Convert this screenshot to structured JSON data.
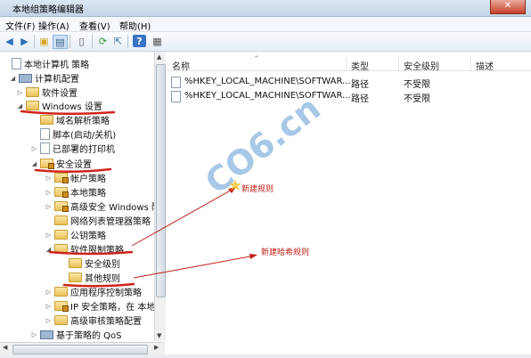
{
  "window": {
    "title": "本地组策略编辑器",
    "close_glyph": "✕"
  },
  "menu": [
    "文件(F)",
    "操作(A)",
    "查看(V)",
    "帮助(H)"
  ],
  "toolbar_icons": [
    "back-icon",
    "forward-icon",
    "up-folder-icon",
    "show-hide-tree-icon",
    "properties-icon",
    "refresh-icon",
    "export-icon",
    "help-icon",
    "view-icon"
  ],
  "tree": [
    {
      "label": "本地计算机 策略",
      "expander": "",
      "icon": "doc"
    },
    {
      "label": "计算机配置",
      "expander": "◢",
      "icon": "comp"
    },
    {
      "label": "软件设置",
      "expander": "▷",
      "icon": "folder"
    },
    {
      "label": "Windows 设置",
      "expander": "◢",
      "icon": "folder"
    },
    {
      "label": "域名解析策略",
      "expander": "",
      "icon": "folder"
    },
    {
      "label": "脚本(启动/关机)",
      "expander": "",
      "icon": "doc"
    },
    {
      "label": "已部署的打印机",
      "expander": "▷",
      "icon": "doc"
    },
    {
      "label": "安全设置",
      "expander": "◢",
      "icon": "lock"
    },
    {
      "label": "帐户策略",
      "expander": "▷",
      "icon": "lock"
    },
    {
      "label": "本地策略",
      "expander": "▷",
      "icon": "lock"
    },
    {
      "label": "高级安全 Windows 防",
      "expander": "▷",
      "icon": "lock"
    },
    {
      "label": "网络列表管理器策略",
      "expander": "",
      "icon": "folder"
    },
    {
      "label": "公钥策略",
      "expander": "▷",
      "icon": "folder"
    },
    {
      "label": "软件限制策略",
      "expander": "◢",
      "icon": "folder"
    },
    {
      "label": "安全级别",
      "expander": "",
      "icon": "folder"
    },
    {
      "label": "其他规则",
      "expander": "",
      "icon": "folder"
    },
    {
      "label": "应用程序控制策略",
      "expander": "▷",
      "icon": "folder"
    },
    {
      "label": "IP 安全策略，在 本地",
      "expander": "▷",
      "icon": "lock"
    },
    {
      "label": "高级审核策略配置",
      "expander": "▷",
      "icon": "folder"
    },
    {
      "label": "基于策略的 QoS",
      "expander": "▷",
      "icon": "comp"
    }
  ],
  "list": {
    "headers": {
      "name": "名称",
      "type": "类型",
      "level": "安全级别",
      "desc": "描述"
    },
    "rows": [
      {
        "name": "%HKEY_LOCAL_MACHINE\\SOFTWAR...",
        "type": "路径",
        "level": "不受限",
        "desc": ""
      },
      {
        "name": "%HKEY_LOCAL_MACHINE\\SOFTWAR...",
        "type": "路径",
        "level": "不受限",
        "desc": ""
      }
    ]
  },
  "annotations": {
    "new_rule": "新建规则",
    "new_hash_rule": "新建哈希规则",
    "watermark": "CO6.cn"
  },
  "colors": {
    "annotation_red": "#c0201a",
    "watermark_blue": "#3e86c8"
  }
}
